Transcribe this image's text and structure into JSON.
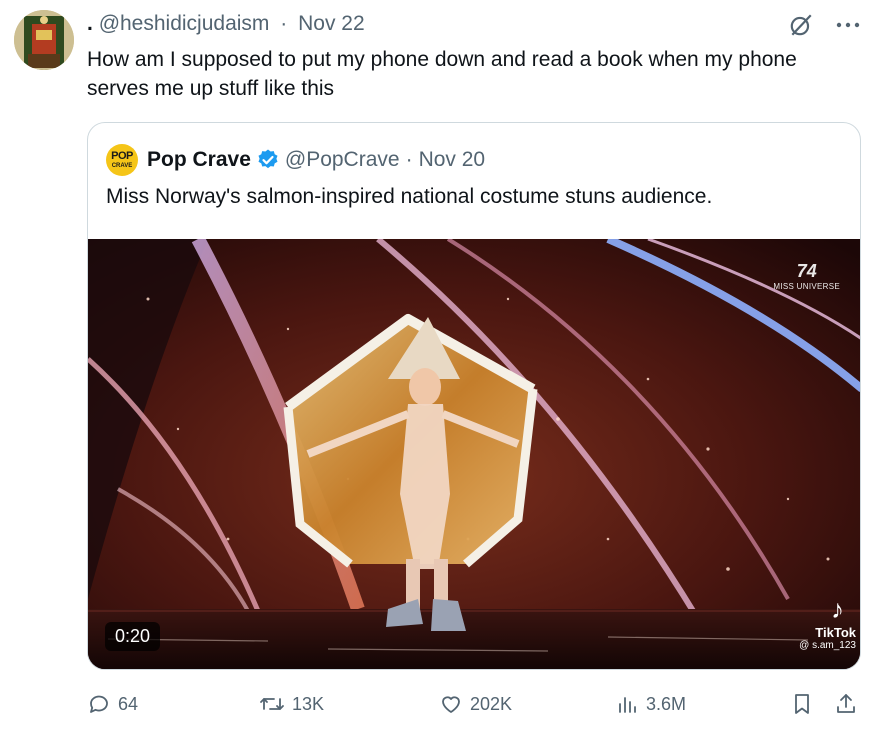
{
  "tweet": {
    "author_name": ".",
    "handle": "@heshidicjudaism",
    "date": "Nov 22",
    "text": "How am I supposed to put my phone down and read a book when my phone serves me up stuff like this"
  },
  "quote": {
    "logo_text": "POP",
    "logo_subtext": "CRAVE",
    "name": "Pop Crave",
    "handle": "@PopCrave",
    "date": "Nov 20",
    "text": "Miss Norway's salmon-inspired national costume stuns audience.",
    "video": {
      "duration": "0:20",
      "watermark_logo": "TikTok",
      "watermark_user": "@ s.am_123",
      "overlay_number": "74",
      "overlay_text": "MISS UNIVERSE"
    }
  },
  "actions": {
    "replies": "64",
    "reposts": "13K",
    "likes": "202K",
    "views": "3.6M"
  },
  "icons": {
    "grok": "grok-icon",
    "more": "more-icon",
    "reply": "reply-icon",
    "repost": "repost-icon",
    "like": "like-icon",
    "views": "views-icon",
    "bookmark": "bookmark-icon",
    "share": "share-icon",
    "verified": "verified-badge-icon"
  },
  "colors": {
    "verified_blue": "#1d9bf0",
    "secondary_text": "#536471",
    "border": "#cfd9de"
  }
}
